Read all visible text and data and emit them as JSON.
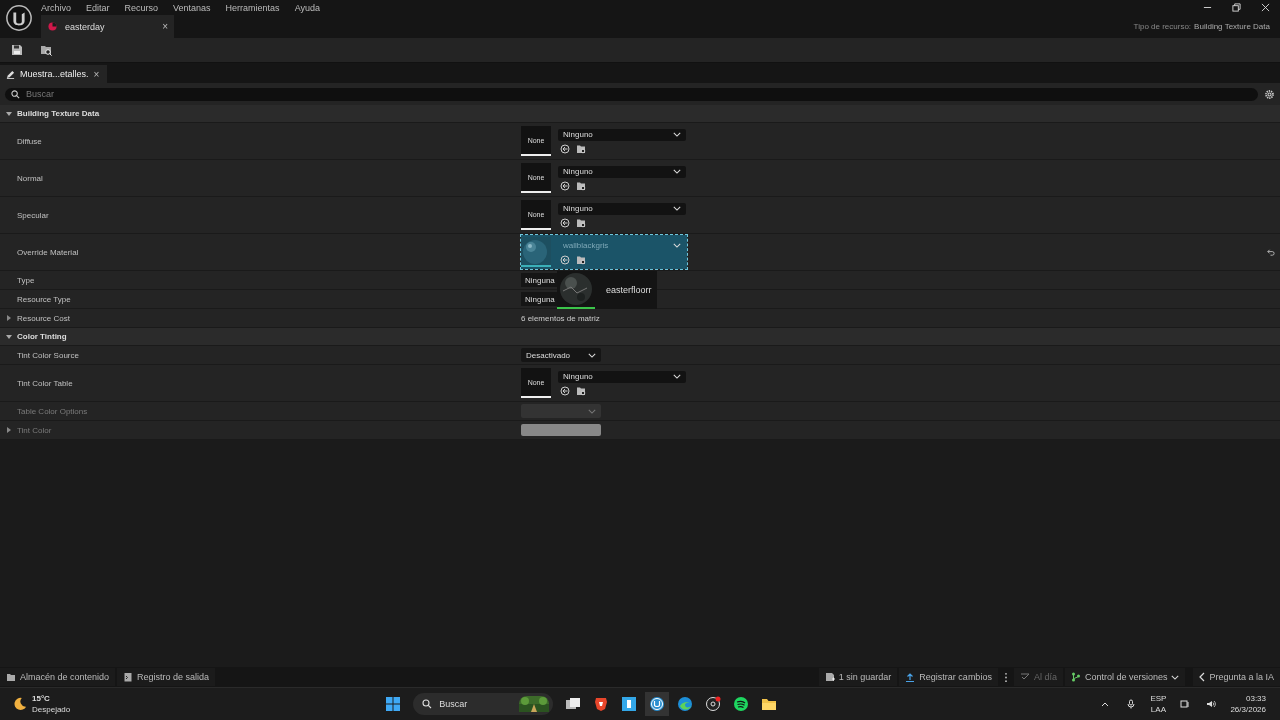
{
  "menu": [
    "Archivo",
    "Editar",
    "Recurso",
    "Ventanas",
    "Herramientas",
    "Ayuda"
  ],
  "document_tab": {
    "title": "easterday",
    "close": "×",
    "selected": true
  },
  "asset_type": {
    "label": "Tipo de recurso:",
    "value": "Building Texture Data"
  },
  "panel_tab": {
    "title": "Muestra...etalles.",
    "close": "×",
    "selected": true
  },
  "search": {
    "placeholder": "Buscar"
  },
  "categories": [
    {
      "title": "Building Texture Data",
      "expanded": true,
      "rows": [
        {
          "label": "Diffuse",
          "kind": "asset",
          "thumbnail": "None",
          "value": "Ninguno",
          "drop_target": false,
          "disabled": false
        },
        {
          "label": "Normal",
          "kind": "asset",
          "thumbnail": "None",
          "value": "Ninguno",
          "drop_target": false,
          "disabled": false
        },
        {
          "label": "Specular",
          "kind": "asset",
          "thumbnail": "None",
          "value": "Ninguno",
          "drop_target": false,
          "disabled": false
        },
        {
          "label": "Override Material",
          "kind": "asset",
          "value": "wallblackgris",
          "drop_target": true,
          "disabled": false
        },
        {
          "label": "Type",
          "kind": "enum",
          "value": "Ninguna",
          "disabled": false
        },
        {
          "label": "Resource Type",
          "kind": "enum",
          "value": "Ninguna",
          "disabled": false
        },
        {
          "label": "Resource Cost",
          "kind": "array",
          "value": "6 elementos de matriz",
          "expanded": false,
          "disabled": false
        }
      ]
    },
    {
      "title": "Color Tinting",
      "expanded": true,
      "rows": [
        {
          "label": "Tint Color Source",
          "kind": "combo",
          "value": "Desactivado",
          "disabled": false
        },
        {
          "label": "Tint Color Table",
          "kind": "asset",
          "thumbnail": "None",
          "value": "Ninguno",
          "drop_target": false,
          "disabled": false
        },
        {
          "label": "Table Color Options",
          "kind": "combo",
          "disabled": true
        },
        {
          "label": "Tint Color",
          "kind": "color",
          "expanded": false,
          "disabled": true
        }
      ]
    }
  ],
  "drag_tooltip": {
    "label": "easterfloorr"
  },
  "status_bar": {
    "left": [
      "Almacén de contenido",
      "Registro de salida"
    ],
    "unsaved": "1 sin guardar",
    "commit": "Registrar cambios",
    "sync": "Al día",
    "source_control": "Control de versiones",
    "ask_ai": "Pregunta a la IA"
  },
  "taskbar": {
    "temperature": "15°C",
    "weather": "Despejado",
    "search": {
      "placeholder": "Buscar"
    },
    "language": "ESP",
    "layout": "LAA",
    "time": "03:33",
    "date": "26/3/2026"
  }
}
